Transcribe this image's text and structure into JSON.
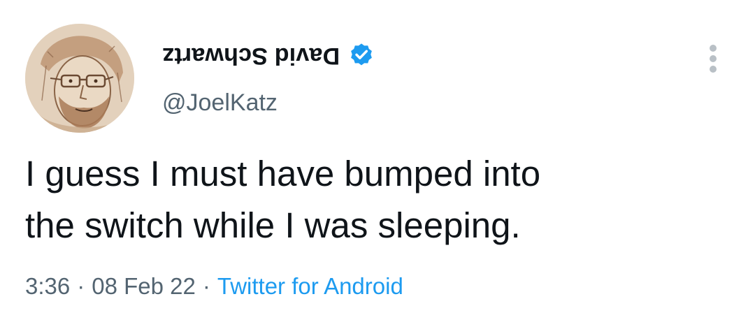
{
  "tweet": {
    "display_name": "David Schwartz",
    "handle": "@JoelKatz",
    "text_line_1": "I guess I must have bumped into",
    "text_line_2": "the switch while I was sleeping.",
    "time": "3:36",
    "date": "08 Feb 22",
    "separator": "·",
    "source": "Twitter for Android"
  },
  "icons": {
    "avatar": "sketch-portrait-avatar",
    "verified": "verified-badge-icon",
    "more": "more-options-icon"
  },
  "colors": {
    "text_primary": "#0f1419",
    "text_secondary": "#536471",
    "accent": "#1d9bf0",
    "more_dots": "#b9c0c6"
  }
}
